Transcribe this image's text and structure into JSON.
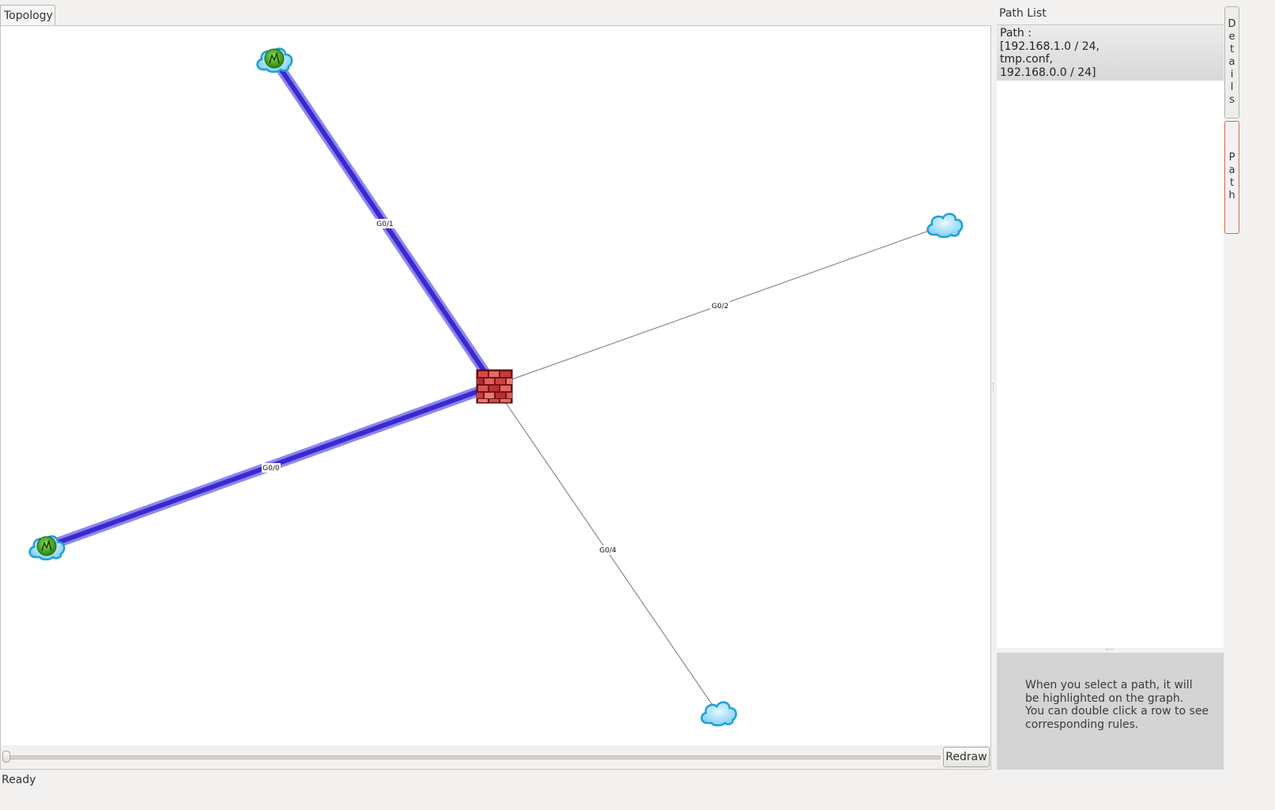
{
  "topology_tab": {
    "label": "Topology"
  },
  "graph": {
    "edges": [
      {
        "label": "G0/1",
        "highlighted": true
      },
      {
        "label": "G0/0",
        "highlighted": true
      },
      {
        "label": "G0/2",
        "highlighted": false
      },
      {
        "label": "G0/4",
        "highlighted": false
      }
    ],
    "nodes": [
      {
        "type": "firewall",
        "icon": "firewall-icon"
      },
      {
        "type": "network",
        "icon": "cloud-green-globe-icon",
        "highlighted": true
      },
      {
        "type": "network",
        "icon": "cloud-green-globe-icon",
        "highlighted": true
      },
      {
        "type": "network",
        "icon": "cloud-icon",
        "highlighted": false
      },
      {
        "type": "network",
        "icon": "cloud-icon",
        "highlighted": false
      }
    ],
    "highlight_color": "#4a3ad8",
    "link_color": "#8a8a8a"
  },
  "controls": {
    "redraw_label": "Redraw"
  },
  "path_list": {
    "title": "Path List",
    "rows": [
      {
        "lines": [
          "Path :",
          "[192.168.1.0 / 24,",
          "tmp.conf,",
          "192.168.0.0 / 24]"
        ]
      }
    ]
  },
  "info": {
    "lines": [
      "When you select a path, it will",
      "be highlighted on the graph.",
      "You can double click a row to see",
      "corresponding rules."
    ]
  },
  "side_tabs": {
    "details": "Details",
    "path": "Path"
  },
  "status": {
    "text": "Ready"
  }
}
